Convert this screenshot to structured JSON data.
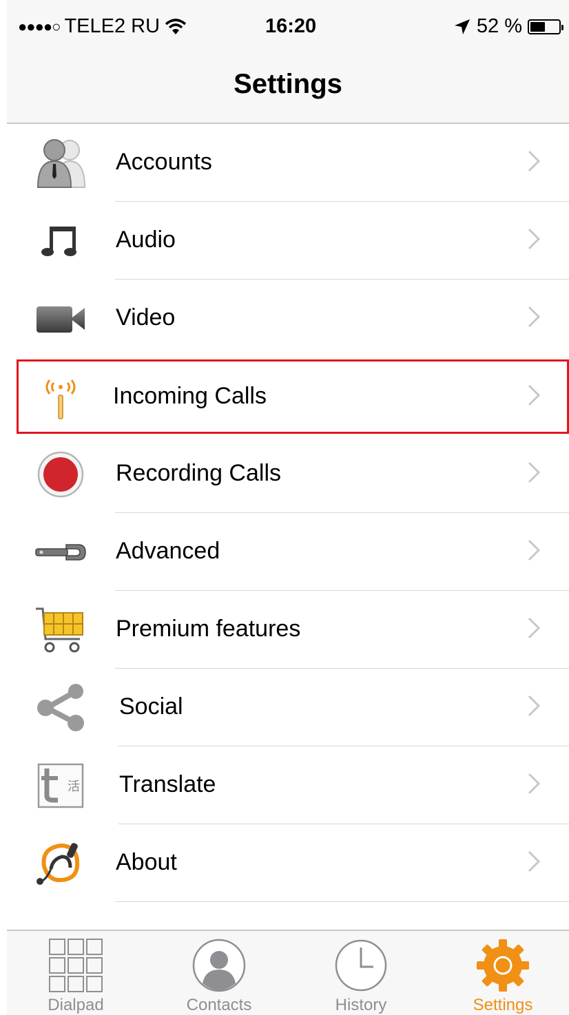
{
  "status_bar": {
    "signal": "●●●●○",
    "carrier": "TELE2 RU",
    "time": "16:20",
    "battery": "52 %",
    "battery_level": 0.52
  },
  "nav": {
    "title": "Settings"
  },
  "rows": [
    {
      "label": "Accounts",
      "icon": "accounts-icon"
    },
    {
      "label": "Audio",
      "icon": "music-note-icon"
    },
    {
      "label": "Video",
      "icon": "video-camera-icon"
    },
    {
      "label": "Incoming Calls",
      "icon": "antenna-icon",
      "highlighted": true
    },
    {
      "label": "Recording Calls",
      "icon": "record-icon"
    },
    {
      "label": "Advanced",
      "icon": "wrench-icon"
    },
    {
      "label": "Premium features",
      "icon": "shopping-cart-icon"
    },
    {
      "label": "Social",
      "icon": "share-icon"
    },
    {
      "label": "Translate",
      "icon": "translate-icon"
    },
    {
      "label": "About",
      "icon": "headset-icon"
    }
  ],
  "tabs": [
    {
      "label": "Dialpad",
      "icon": "dialpad-icon"
    },
    {
      "label": "Contacts",
      "icon": "contacts-icon"
    },
    {
      "label": "History",
      "icon": "clock-icon"
    },
    {
      "label": "Settings",
      "icon": "gear-icon",
      "active": true
    }
  ],
  "colors": {
    "accent": "#f09015",
    "highlight_border": "#e0161d"
  }
}
